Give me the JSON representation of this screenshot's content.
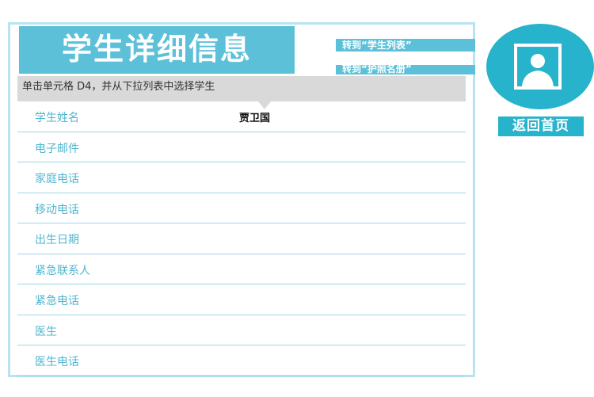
{
  "header": {
    "title": "学生详细信息"
  },
  "nav": {
    "goto_student_list": "转到“学生列表”",
    "goto_second": "转到“护照名册”"
  },
  "tooltip": {
    "text": "单击单元格 D4，并从下拉列表中选择学生"
  },
  "details": {
    "rows": [
      {
        "label": "学生姓名",
        "value": "贾卫国"
      },
      {
        "label": "电子邮件",
        "value": ""
      },
      {
        "label": "家庭电话",
        "value": ""
      },
      {
        "label": "移动电话",
        "value": ""
      },
      {
        "label": "出生日期",
        "value": ""
      },
      {
        "label": "紧急联系人",
        "value": ""
      },
      {
        "label": "紧急电话",
        "value": ""
      },
      {
        "label": "医生",
        "value": ""
      },
      {
        "label": "医生电话",
        "value": ""
      }
    ]
  },
  "sidebar": {
    "home_button": "返回首页",
    "avatar_icon": "person-photo-icon"
  },
  "colors": {
    "accent": "#5cc0d8",
    "dark_accent": "#27b3cb",
    "border": "#b9e3ef",
    "tooltip_bg": "#d9d9d9"
  }
}
